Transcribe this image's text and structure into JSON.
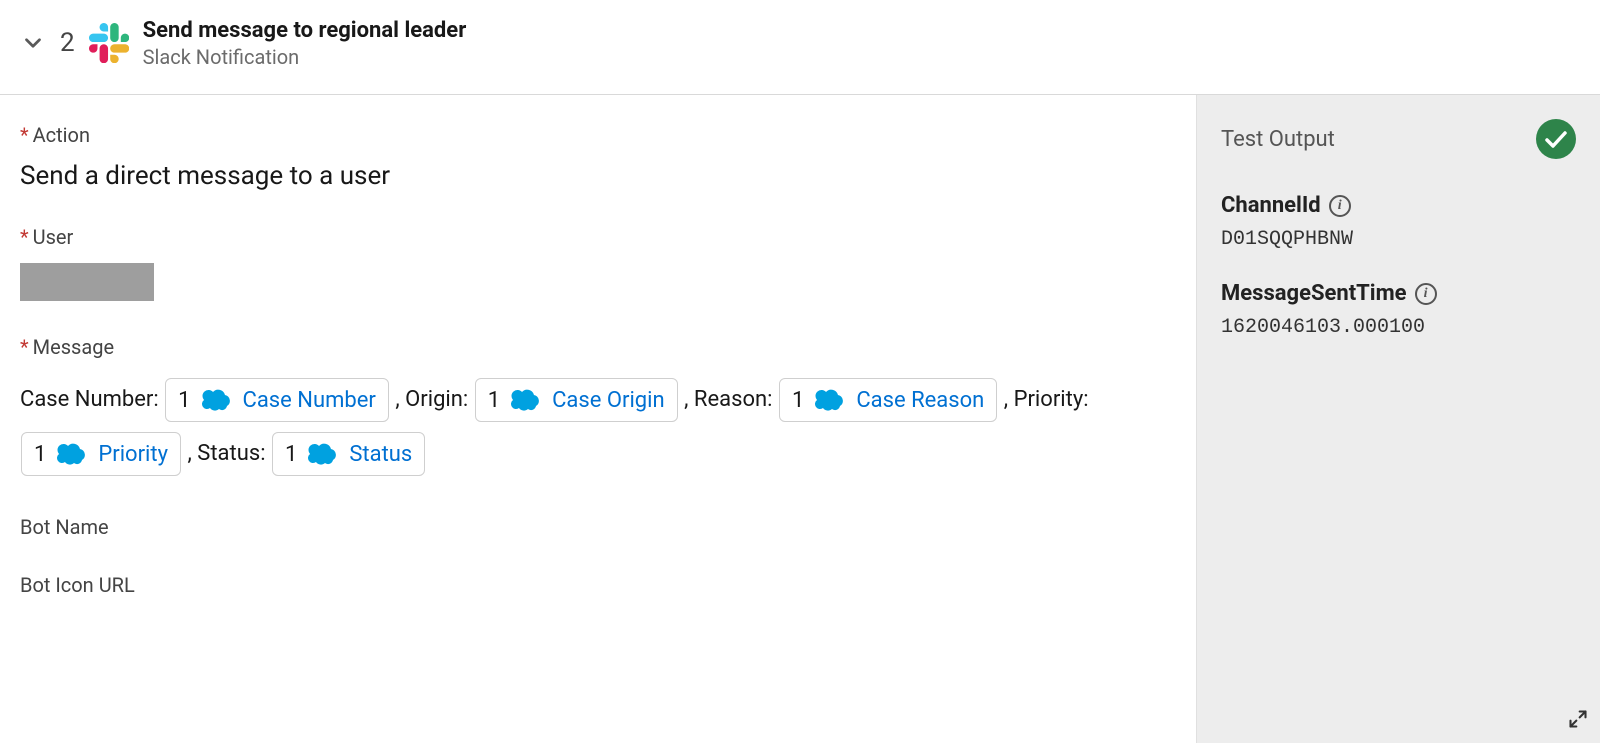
{
  "header": {
    "step_number": "2",
    "title": "Send message to regional leader",
    "subtitle": "Slack Notification"
  },
  "form": {
    "action": {
      "label": "Action",
      "value": "Send a direct message to a user"
    },
    "user": {
      "label": "User"
    },
    "message": {
      "label": "Message",
      "parts": [
        {
          "text": "Case Number: ",
          "pill_num": "1",
          "pill_field": "Case Number"
        },
        {
          "text": ", Origin: ",
          "pill_num": "1",
          "pill_field": "Case Origin"
        },
        {
          "text": ", Reason: ",
          "pill_num": "1",
          "pill_field": "Case Reason"
        },
        {
          "text": ", Priority: ",
          "pill_num": "1",
          "pill_field": "Priority"
        },
        {
          "text": ", Status: ",
          "pill_num": "1",
          "pill_field": "Status"
        }
      ]
    },
    "bot_name": {
      "label": "Bot Name"
    },
    "bot_icon_url": {
      "label": "Bot Icon URL"
    }
  },
  "output": {
    "panel_title": "Test Output",
    "fields": [
      {
        "label": "ChannelId",
        "value": "D01SQQPHBNW"
      },
      {
        "label": "MessageSentTime",
        "value": "1620046103.000100"
      }
    ]
  }
}
